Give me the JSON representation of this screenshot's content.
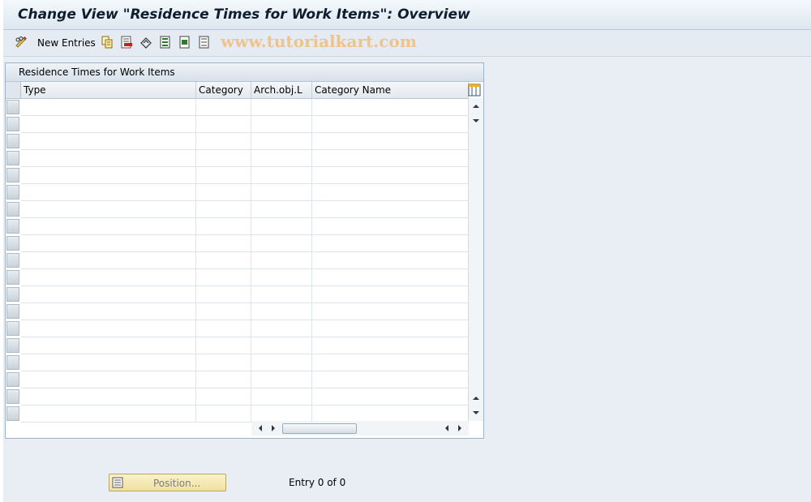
{
  "window": {
    "title": "Change View \"Residence Times for Work Items\": Overview"
  },
  "toolbar": {
    "new_entries_label": "New Entries",
    "icons": [
      "glasses-edit-icon",
      "copy-icon",
      "delete-icon",
      "undo-icon",
      "select-all-icon",
      "select-block-icon",
      "deselect-all-icon"
    ],
    "watermark": "www.tutorialkart.com"
  },
  "table": {
    "title": "Residence Times for Work Items",
    "columns": [
      "Type",
      "Category",
      "Arch.obj.L",
      "Category Name"
    ],
    "rows": []
  },
  "footer": {
    "position_label": "Position...",
    "entry_text": "Entry 0 of 0"
  }
}
